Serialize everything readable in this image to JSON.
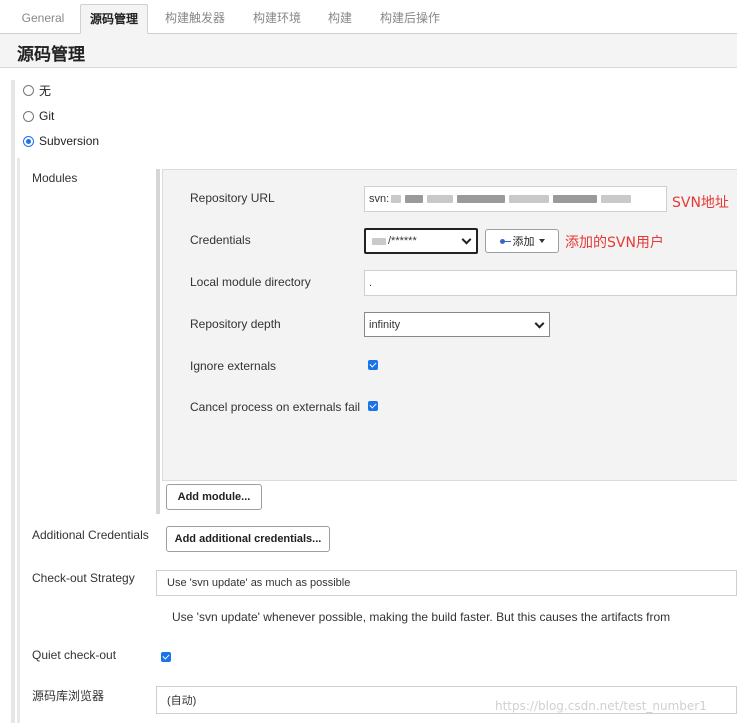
{
  "tabs": [
    "General",
    "源码管理",
    "构建触发器",
    "构建环境",
    "构建",
    "构建后操作"
  ],
  "active_tab": "源码管理",
  "section_title": "源码管理",
  "scm_options": [
    {
      "label": "无",
      "checked": false
    },
    {
      "label": "Git",
      "checked": false
    },
    {
      "label": "Subversion",
      "checked": true
    }
  ],
  "modules": {
    "label": "Modules",
    "repository_url": {
      "label": "Repository URL",
      "value_prefix": "svn:",
      "annotation": "SVN地址"
    },
    "credentials": {
      "label": "Credentials",
      "selected": "/******",
      "add_button": "添加",
      "annotation": "添加的SVN用户"
    },
    "local_module_directory": {
      "label": "Local module directory",
      "value": "."
    },
    "repository_depth": {
      "label": "Repository depth",
      "selected": "infinity"
    },
    "ignore_externals": {
      "label": "Ignore externals",
      "checked": true
    },
    "cancel_process": {
      "label": "Cancel process on externals fail",
      "checked": true
    },
    "add_module_button": "Add module..."
  },
  "additional_credentials": {
    "label": "Additional Credentials",
    "button": "Add additional credentials..."
  },
  "checkout_strategy": {
    "label": "Check-out Strategy",
    "selected": "Use 'svn update' as much as possible",
    "help": "Use 'svn update' whenever possible, making the build faster. But this causes the artifacts from"
  },
  "quiet_checkout": {
    "label": "Quiet check-out",
    "checked": true
  },
  "repo_browser": {
    "label": "源码库浏览器",
    "selected": "(自动)"
  },
  "watermark": "https://blog.csdn.net/test_number1",
  "colors": {
    "accent": "#1a73e8",
    "annotation": "#e53935"
  }
}
